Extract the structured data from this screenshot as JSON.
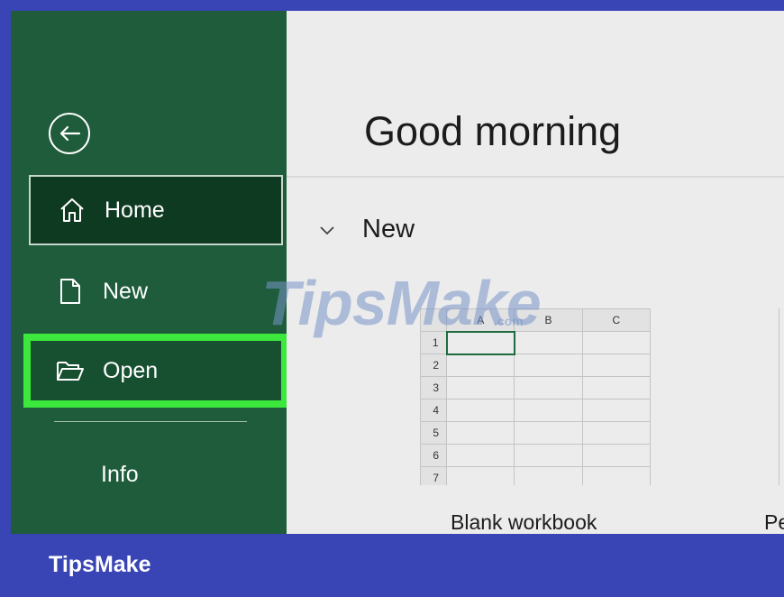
{
  "sidebar": {
    "back_icon": "back-arrow-icon",
    "items": [
      {
        "label": "Home",
        "icon": "home-icon"
      },
      {
        "label": "New",
        "icon": "document-icon"
      },
      {
        "label": "Open",
        "icon": "folder-open-icon"
      },
      {
        "label": "Info"
      }
    ]
  },
  "main": {
    "greeting": "Good morning",
    "section": {
      "label": "New",
      "icon": "chevron-down-icon"
    },
    "templates": [
      {
        "label": "Blank workbook",
        "columns": [
          "A",
          "B",
          "C"
        ],
        "rows": [
          "1",
          "2",
          "3",
          "4",
          "5",
          "6",
          "7"
        ]
      },
      {
        "label": "Pe"
      }
    ]
  },
  "watermark": {
    "text": "TipsMake",
    "suffix": ".com"
  },
  "footer": {
    "brand": "TipsMake"
  },
  "colors": {
    "sidebar": "#1e5c3b",
    "home_selected": "#0f3a22",
    "highlight": "#3ce83c",
    "frame": "#3a45b5",
    "main_bg": "#ececec"
  }
}
